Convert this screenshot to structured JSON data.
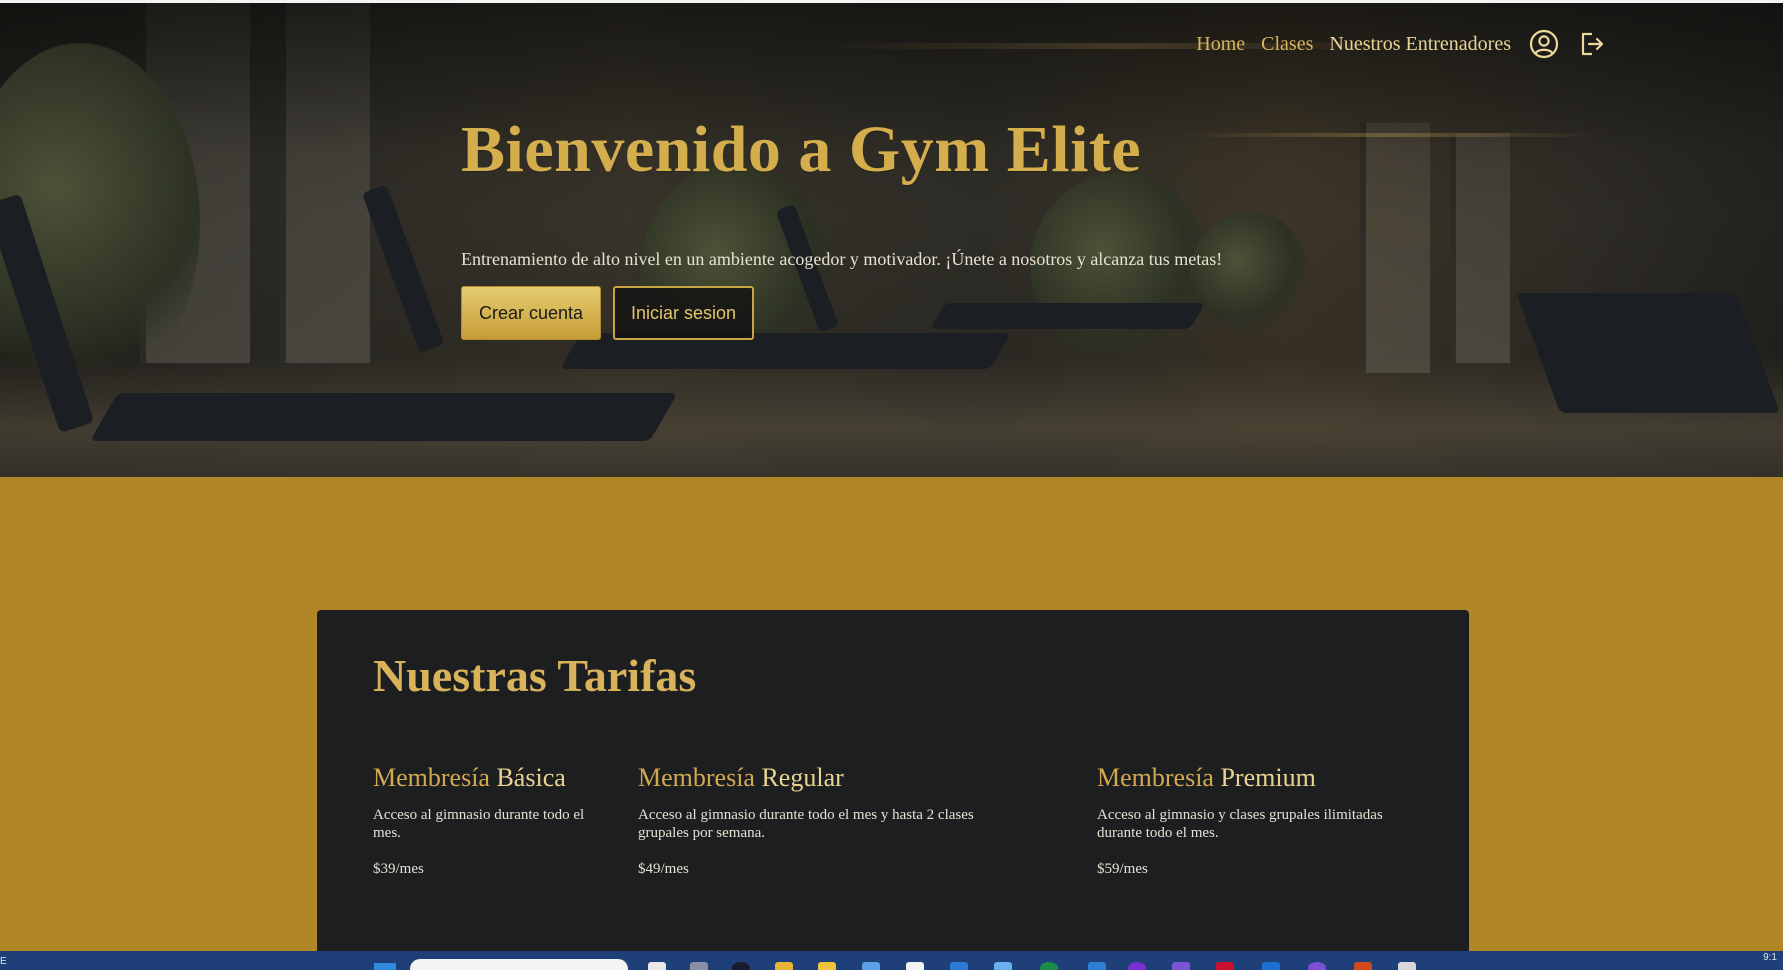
{
  "nav": {
    "items": [
      "Home",
      "Clases",
      "Nuestros Entrenadores"
    ],
    "icons": [
      "user-circle-icon",
      "logout-icon"
    ]
  },
  "hero": {
    "title": "Bienvenido a Gym Elite",
    "subtitle": "Entrenamiento de alto nivel en un ambiente acogedor y motivador. ¡Únete a nosotros y alcanza tus metas!",
    "primary_button": "Crear cuenta",
    "secondary_button": "Iniciar sesion"
  },
  "pricing": {
    "title": "Nuestras Tarifas",
    "plans": [
      {
        "name_a": "Membresía",
        "name_b": "Básica",
        "description": "Acceso al gimnasio durante todo el mes.",
        "price": "$39/mes"
      },
      {
        "name_a": "Membresía",
        "name_b": "Regular",
        "description": "Acceso al gimnasio durante todo el mes y hasta 2 clases grupales por semana.",
        "price": "$49/mes"
      },
      {
        "name_a": "Membresía",
        "name_b": "Premium",
        "description": "Acceso al gimnasio y clases grupales ilimitadas durante todo el mes.",
        "price": "$59/mes"
      }
    ]
  },
  "taskbar": {
    "clock": "9:1",
    "left_edge": "E"
  },
  "colors": {
    "gold": "#d4ad4c",
    "page_background": "#b08627",
    "card_background": "#1d1e20",
    "taskbar": "#1e3f78"
  }
}
